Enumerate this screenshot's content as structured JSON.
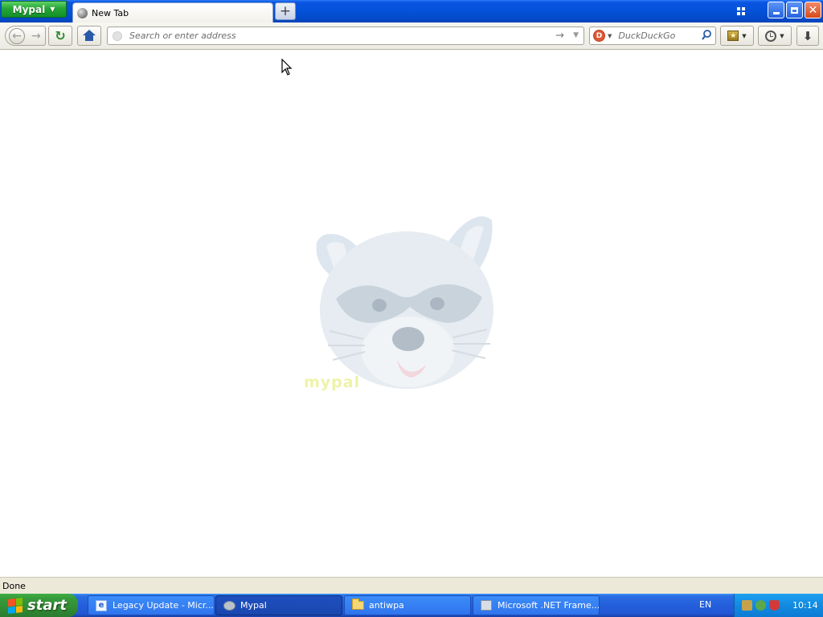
{
  "app_button": {
    "label": "Mypal"
  },
  "tab": {
    "title": "New Tab"
  },
  "urlbar": {
    "placeholder": "Search or enter address"
  },
  "searchbar": {
    "engine": "DuckDuckGo",
    "placeholder": "DuckDuckGo"
  },
  "page": {
    "watermark": "mypal"
  },
  "status": {
    "text": "Done"
  },
  "taskbar": {
    "start_label": "start",
    "tasks": [
      {
        "label": "Legacy Update - Micr..."
      },
      {
        "label": "Mypal"
      },
      {
        "label": "antiwpa"
      },
      {
        "label": "Microsoft .NET Frame..."
      }
    ],
    "language": "EN",
    "time": "10:14"
  },
  "colors": {
    "title_blue": "#0452d8",
    "app_button_green": "#26a634",
    "taskbar_blue": "#245edb",
    "start_green": "#318e35",
    "tray_blue": "#128ae0"
  }
}
